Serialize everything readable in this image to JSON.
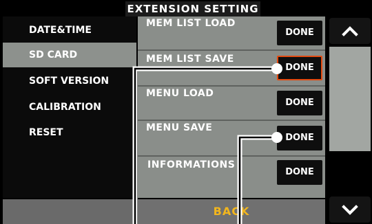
{
  "header": {
    "title": "EXTENSION SETTING"
  },
  "sidebar": {
    "items": [
      {
        "label": "DATE&TIME",
        "selected": false
      },
      {
        "label": "SD CARD",
        "selected": true
      },
      {
        "label": "SOFT VERSION",
        "selected": false
      },
      {
        "label": "CALIBRATION",
        "selected": false
      },
      {
        "label": "RESET",
        "selected": false
      }
    ]
  },
  "rows": [
    {
      "label": "MEM LIST LOAD",
      "button": "DONE"
    },
    {
      "label": "MEM LIST SAVE",
      "button": "DONE"
    },
    {
      "label": "MENU LOAD",
      "button": "DONE"
    },
    {
      "label": "MENU SAVE",
      "button": "DONE"
    },
    {
      "label": "INFORMATIONS",
      "button": "DONE"
    }
  ],
  "footer": {
    "back_label": "BACK"
  },
  "scroll": {
    "up_icon": "chevron-up-icon",
    "down_icon": "chevron-down-icon"
  },
  "colors": {
    "back_text": "#f2b61d",
    "highlight_border": "#e34a10",
    "selected_bg": "#8d918d",
    "panel_bg": "#8a8e8a"
  }
}
